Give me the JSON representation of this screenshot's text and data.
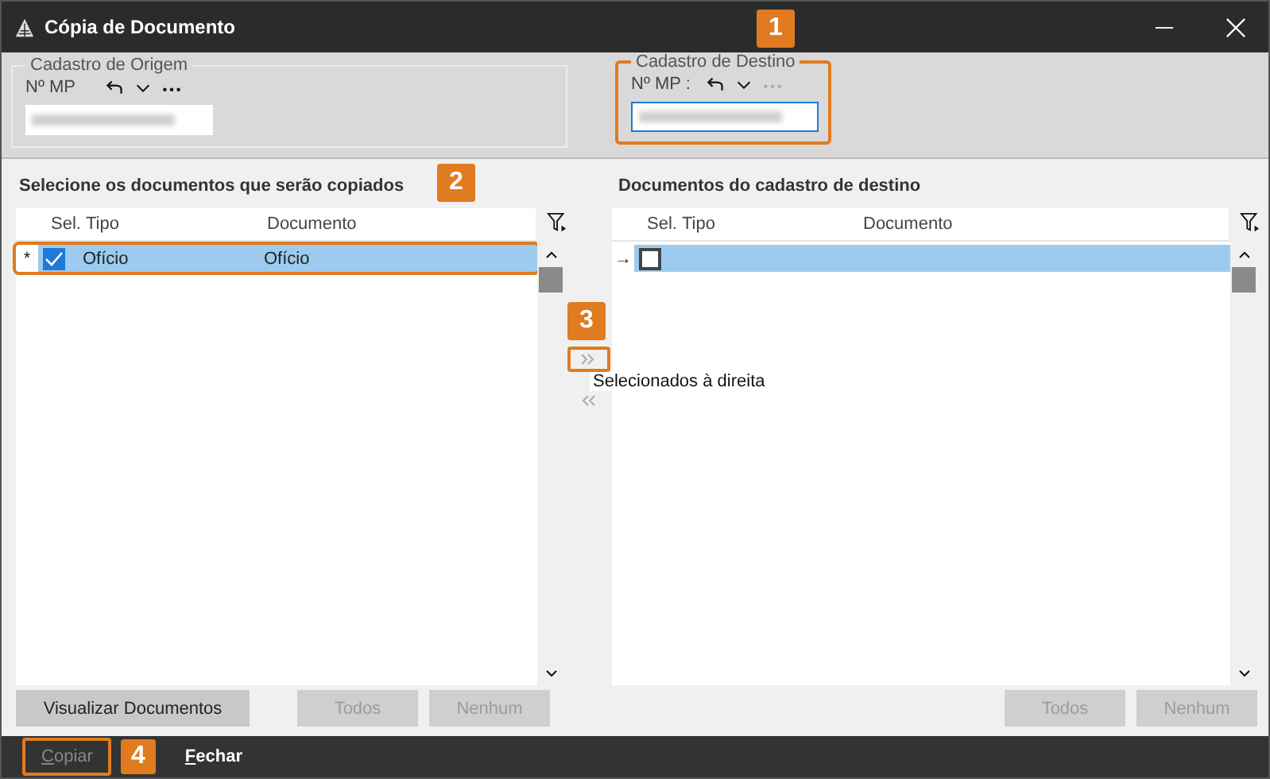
{
  "window": {
    "title": "Cópia de Documento"
  },
  "origin": {
    "legend": "Cadastro de Origem",
    "label": "Nº MP",
    "more_enabled": true
  },
  "destination": {
    "legend": "Cadastro de Destino",
    "label": "Nº MP :",
    "more_enabled": false,
    "highlighted": true,
    "callout": "1"
  },
  "left_panel": {
    "heading": "Selecione os documentos que serão copiados",
    "columns": [
      "Sel.",
      "Tipo",
      "Documento"
    ],
    "rows": [
      {
        "marker": "*",
        "checked": true,
        "selected": true,
        "highlighted": true,
        "tipo": "Ofício",
        "documento": "Ofício"
      }
    ],
    "callout": "2",
    "buttons": [
      {
        "label": "Visualizar Documentos",
        "disabled": false
      },
      {
        "label": "Todos",
        "disabled": true
      },
      {
        "label": "Nenhum",
        "disabled": true
      }
    ]
  },
  "transfer": {
    "callout": "3",
    "tooltip": "Selecionados à direita",
    "buttons": [
      {
        "kind": "add",
        "highlighted": true
      },
      {
        "kind": "remove",
        "highlighted": false
      }
    ]
  },
  "right_panel": {
    "heading": "Documentos do cadastro de destino",
    "columns": [
      "Sel.",
      "Tipo",
      "Documento"
    ],
    "rows": [
      {
        "marker": "→",
        "checked": false,
        "selected": true
      }
    ],
    "buttons": [
      {
        "label": "Todos",
        "disabled": true
      },
      {
        "label": "Nenhum",
        "disabled": true
      }
    ]
  },
  "footer": {
    "callout": "4",
    "buttons": [
      {
        "label": "Copiar",
        "disabled": true,
        "highlighted": true
      },
      {
        "label": "Fechar",
        "disabled": false,
        "highlighted": false
      }
    ]
  }
}
